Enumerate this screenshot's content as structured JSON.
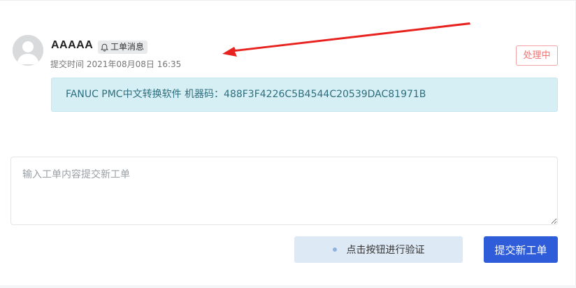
{
  "ticket": {
    "username": "AAAAA",
    "tag_label": "工单消息",
    "submit_time": "提交时间 2021年08月08日 16:35",
    "status": "处理中",
    "message": "FANUC PMC中文转换软件 机器码：488F3F4226C5B4544C20539DAC81971B"
  },
  "composer": {
    "placeholder": "输入工单内容提交新工单",
    "verify_label": "点击按钮进行验证",
    "submit_label": "提交新工单"
  },
  "icons": {
    "avatar": "user-avatar-icon",
    "tag": "bell-icon",
    "annotation": "red-arrow"
  },
  "colors": {
    "status": "#f07070",
    "message_bg": "#d6eff5",
    "submit_bg": "#2f5dd9",
    "arrow": "#e8231f"
  }
}
